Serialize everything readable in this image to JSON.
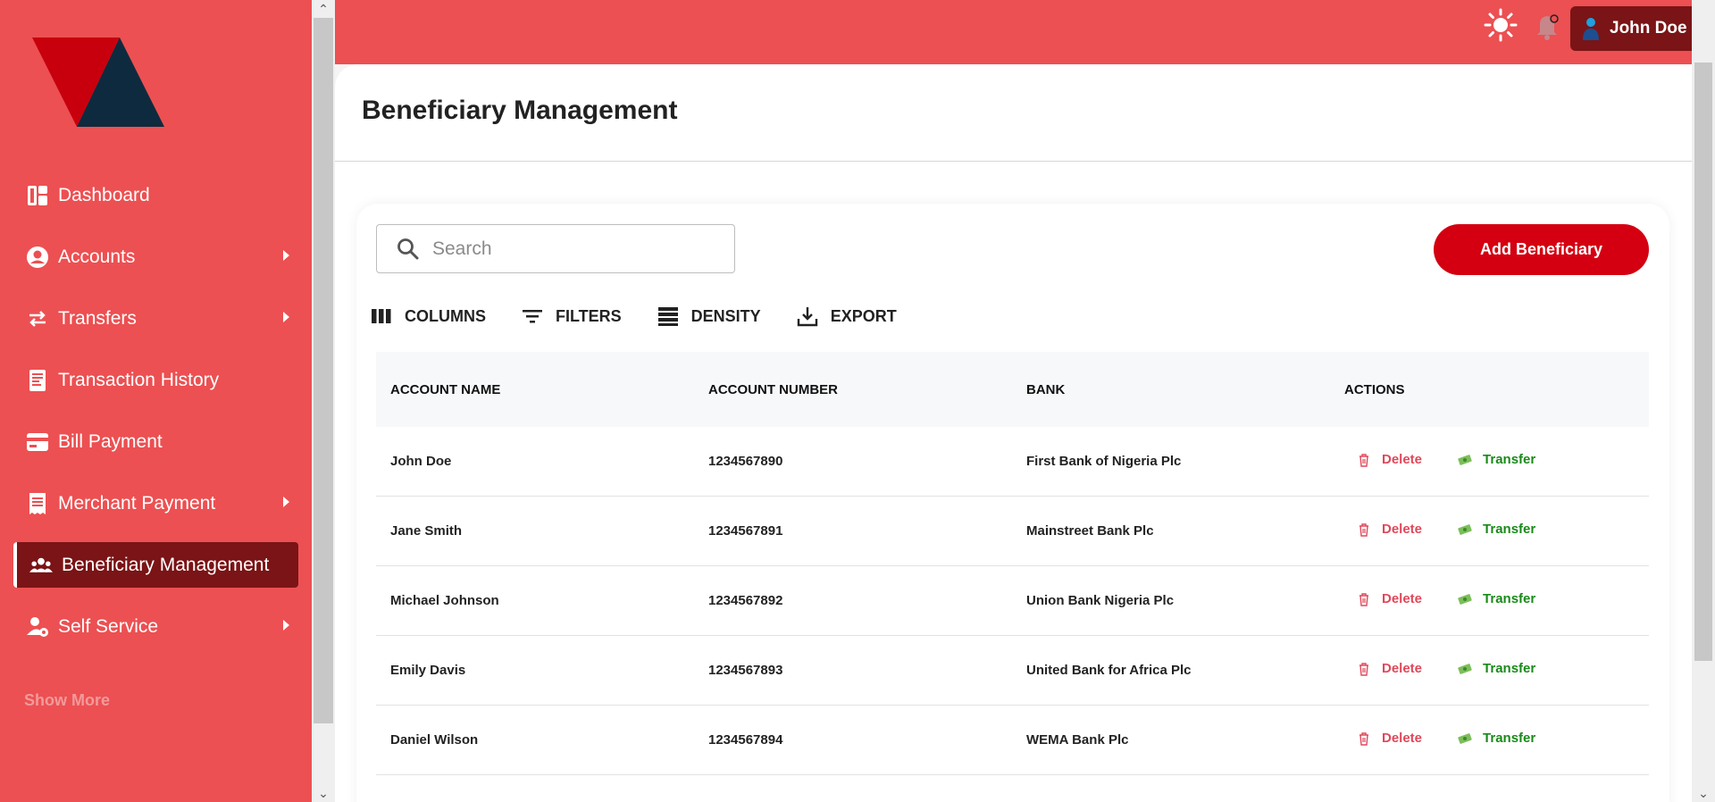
{
  "sidebar": {
    "items": [
      {
        "label": "Dashboard",
        "icon": "dashboard-icon",
        "has_submenu": false
      },
      {
        "label": "Accounts",
        "icon": "account-circle-icon",
        "has_submenu": true
      },
      {
        "label": "Transfers",
        "icon": "transfer-arrows-icon",
        "has_submenu": true
      },
      {
        "label": "Transaction History",
        "icon": "receipt-icon",
        "has_submenu": false
      },
      {
        "label": "Bill Payment",
        "icon": "credit-card-icon",
        "has_submenu": false
      },
      {
        "label": "Merchant Payment",
        "icon": "invoice-icon",
        "has_submenu": true
      },
      {
        "label": "Beneficiary Management",
        "icon": "group-icon",
        "has_submenu": false,
        "active": true
      },
      {
        "label": "Self Service",
        "icon": "user-settings-icon",
        "has_submenu": true
      }
    ],
    "show_more": "Show More"
  },
  "header": {
    "user_name": "John Doe"
  },
  "main": {
    "title": "Beneficiary Management",
    "search": {
      "placeholder": "Search",
      "value": ""
    },
    "add_button": "Add Beneficiary",
    "toolbar": {
      "columns": "COLUMNS",
      "filters": "FILTERS",
      "density": "DENSITY",
      "export": "EXPORT"
    },
    "table": {
      "headers": [
        "ACCOUNT NAME",
        "ACCOUNT NUMBER",
        "BANK",
        "ACTIONS"
      ],
      "rows": [
        {
          "name": "John Doe",
          "number": "1234567890",
          "bank": "First Bank of Nigeria Plc"
        },
        {
          "name": "Jane Smith",
          "number": "1234567891",
          "bank": "Mainstreet Bank Plc"
        },
        {
          "name": "Michael Johnson",
          "number": "1234567892",
          "bank": "Union Bank Nigeria Plc"
        },
        {
          "name": "Emily Davis",
          "number": "1234567893",
          "bank": "United Bank for Africa Plc"
        },
        {
          "name": "Daniel Wilson",
          "number": "1234567894",
          "bank": "WEMA Bank Plc"
        }
      ],
      "delete_label": "Delete",
      "transfer_label": "Transfer"
    }
  },
  "colors": {
    "brand_red": "#ec5052",
    "active_dark": "#7a1416",
    "button_red": "#d40011",
    "delete_red": "#e0485a",
    "transfer_green": "#1a8a1a"
  }
}
